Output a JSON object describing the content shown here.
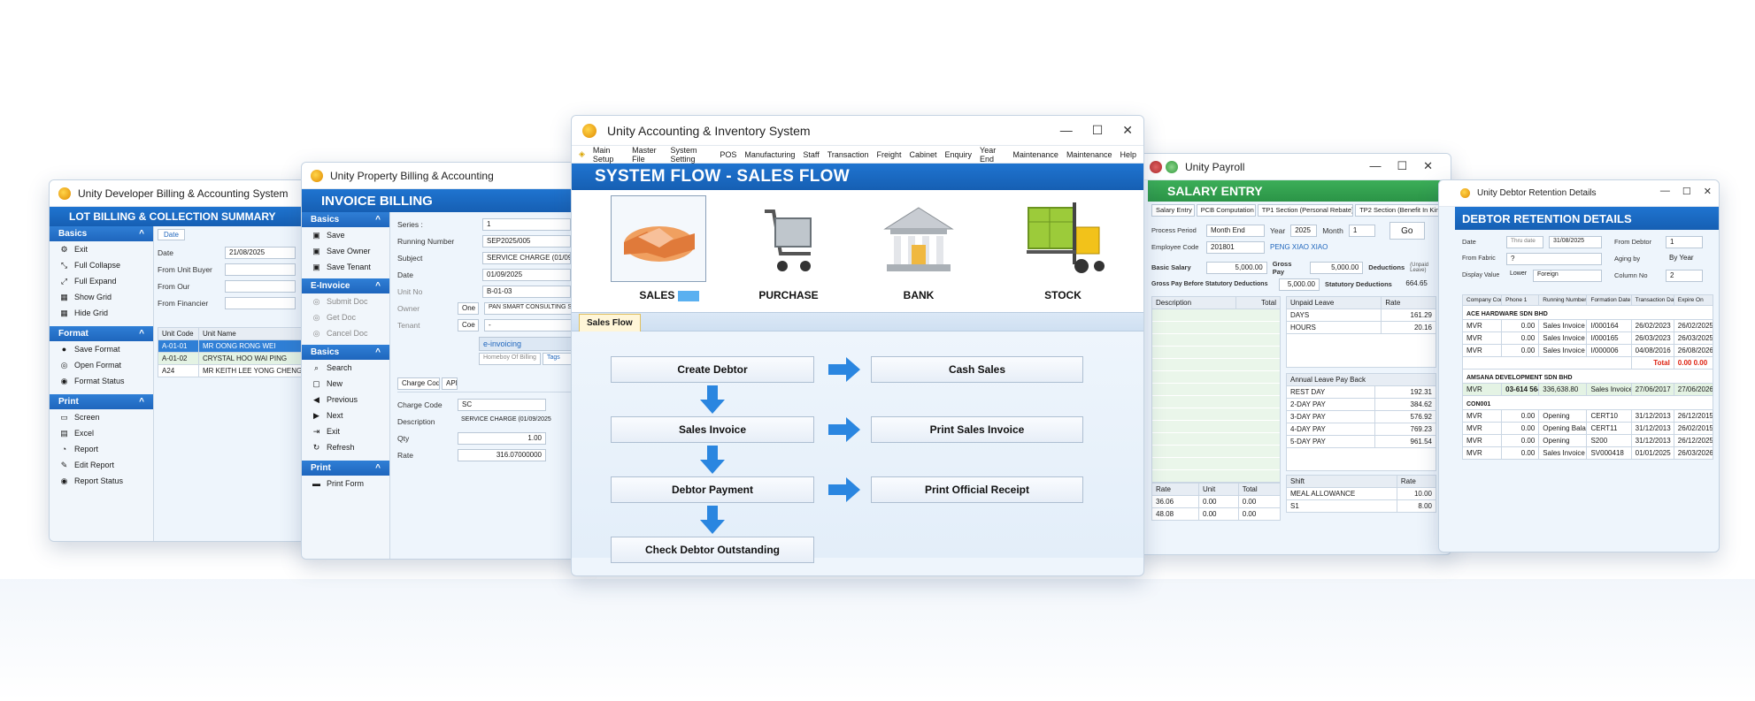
{
  "w1": {
    "title": "Unity Developer Billing & Accounting System",
    "band": "LOT BILLING & COLLECTION SUMMARY",
    "basics": "Basics",
    "basics_items": [
      "Exit",
      "Full Collapse",
      "Full Expand",
      "Show Grid",
      "Hide Grid"
    ],
    "format": "Format",
    "format_items": [
      "Save Format",
      "Open Format",
      "Format Status"
    ],
    "print": "Print",
    "print_items": [
      "Screen",
      "Excel",
      "Report",
      "Edit Report",
      "Report Status"
    ],
    "tab": "Date",
    "filters": [
      {
        "label": "Date",
        "value": "21/08/2025"
      },
      {
        "label": "From Unit Buyer",
        "value": ""
      },
      {
        "label": "From Our",
        "value": ""
      },
      {
        "label": "From Financier",
        "value": ""
      }
    ],
    "cols": [
      "Unit Code",
      "Unit Name"
    ],
    "rows": [
      [
        "A-01-01",
        "MR OONG RONG WEI"
      ],
      [
        "A-01-02",
        "CRYSTAL HOO WAI PING"
      ],
      [
        "A24",
        "MR KEITH LEE YONG CHENG"
      ]
    ]
  },
  "w2": {
    "title": "Unity Property Billing & Accounting",
    "band": "INVOICE BILLING",
    "basics": "Basics",
    "basics_items": [
      "Save",
      "Save Owner",
      "Save Tenant"
    ],
    "einv": "E-Invoice",
    "einv_items": [
      "Submit Doc",
      "Get Doc",
      "Cancel Doc"
    ],
    "basics2": "Basics",
    "basics2_items": [
      "Search",
      "New",
      "Previous",
      "Next",
      "Exit",
      "Refresh"
    ],
    "print": "Print",
    "print_items": [
      "Print Form"
    ],
    "fields": [
      {
        "label": "Series :",
        "value": "1"
      },
      {
        "label": "Running Number",
        "value": "SEP2025/005"
      },
      {
        "label": "Subject",
        "value": "SERVICE CHARGE (01/09/2025"
      },
      {
        "label": "Date",
        "value": "01/09/2025"
      },
      {
        "label": "Unit No",
        "value": "B-01-03"
      }
    ],
    "owner_label": "Owner",
    "owner_btn": "One",
    "owner_val": "PAN SMART CONSULTING SDN",
    "tenant_label": "Tenant",
    "tenant_btn": "Coe",
    "tenant_val": "-",
    "einv_tab": "e-invoicing",
    "homeboy": "Homeboy Of Billing",
    "tags": "Tags",
    "tabs": [
      "Charge Code",
      "API"
    ],
    "charge": [
      {
        "label": "Charge Code",
        "value": "SC"
      },
      {
        "label": "Description",
        "value": "SERVICE CHARGE (01/09/2025"
      },
      {
        "label": "Qty",
        "value": "1.00"
      },
      {
        "label": "Rate",
        "value": "316.07000000"
      }
    ]
  },
  "w3": {
    "title": "Unity Accounting & Inventory System",
    "menu": [
      "Main Setup",
      "Master File",
      "System Setting",
      "POS",
      "Manufacturing",
      "Staff",
      "Transaction",
      "Freight",
      "Cabinet",
      "Enquiry",
      "Year End",
      "Maintenance",
      "Maintenance",
      "Help"
    ],
    "band": "SYSTEM FLOW - SALES FLOW",
    "modules": [
      "SALES",
      "PURCHASE",
      "BANK",
      "STOCK"
    ],
    "tab": "Sales Flow",
    "left": [
      "Create Debtor",
      "Sales Invoice",
      "Debtor Payment",
      "Check Debtor Outstanding"
    ],
    "right": [
      "Cash Sales",
      "Print Sales Invoice",
      "Print Official Receipt"
    ]
  },
  "w4": {
    "title": "Unity Payroll",
    "band": "SALARY ENTRY",
    "tabs": [
      "Salary Entry",
      "PCB Computation",
      "TP1 Section (Personal Rebate)",
      "TP2 Section (Benefit In Kind)"
    ],
    "process_label": "Process Period",
    "process_val": "Month End",
    "year_label": "Year",
    "year_val": "2025",
    "month_label": "Month",
    "month_val": "1",
    "go": "Go",
    "emp_label": "Employee Code",
    "emp_val": "201801",
    "emp_name": "PENG XIAO XIAO",
    "basic_label": "Basic Salary",
    "basic_val": "5,000.00",
    "gross_label": "Gross Pay",
    "gross_val": "5,000.00",
    "ded_label": "Deductions",
    "ded_note": "(Unpaid Leave)",
    "gpb_label": "Gross Pay Before Statutory Deductions",
    "gpb_val": "5,000.00",
    "sd_label": "Statutory Deductions",
    "sd_val": "664.65",
    "desc_cols": [
      "Description",
      "Total"
    ],
    "unpaid_cols": [
      "Unpaid Leave",
      "Rate"
    ],
    "unpaid": [
      [
        "DAYS",
        "161.29"
      ],
      [
        "HOURS",
        "20.16"
      ]
    ],
    "annual": "Annual Leave Pay Back",
    "annual_rows": [
      [
        "REST DAY",
        "192.31"
      ],
      [
        "2-DAY PAY",
        "384.62"
      ],
      [
        "3-DAY PAY",
        "576.92"
      ],
      [
        "4-DAY PAY",
        "769.23"
      ],
      [
        "5-DAY PAY",
        "961.54"
      ]
    ],
    "rate_cols": [
      "Rate",
      "Unit",
      "Total"
    ],
    "rate_rows": [
      [
        "36.06",
        "0.00",
        "0.00"
      ],
      [
        "48.08",
        "0.00",
        "0.00"
      ]
    ],
    "shift_cols": [
      "Shift",
      "Rate"
    ],
    "shift_rows": [
      [
        "MEAL ALLOWANCE",
        "10.00"
      ],
      [
        "S1",
        "8.00"
      ]
    ]
  },
  "w5": {
    "title": "Unity Debtor Retention Details",
    "band": "DEBTOR RETENTION DETAILS",
    "f_date": "Date",
    "f_date_op": "Thru date",
    "f_date_val": "31/08/2025",
    "f_from": "From Debtor",
    "f_from_val": "1",
    "f_fab": "From Fabric",
    "f_fab_val": "?",
    "f_aging": "Aging by",
    "f_aging_val": "By Year",
    "f_disp": "Display Value",
    "f_disp_op": "Lower",
    "f_disp_val": "Foreign",
    "f_col": "Column No",
    "f_col_val": "2",
    "cols": [
      "Company Code",
      "Phone 1",
      "Running Number",
      "Formation Date",
      "Transaction Date",
      "Expire On"
    ],
    "g1": "ACE HARDWARE SDN BHD",
    "g1_rows": [
      [
        "MVR",
        "0.00",
        "Sales Invoice",
        "I/000164",
        "26/02/2023",
        "26/02/2025"
      ],
      [
        "MVR",
        "0.00",
        "Sales Invoice",
        "I/000165",
        "26/03/2023",
        "26/03/2025"
      ],
      [
        "MVR",
        "0.00",
        "Sales Invoice",
        "I/000006",
        "04/08/2016",
        "26/08/2026"
      ]
    ],
    "total_label": "Total",
    "total_val": "0.00 0.00",
    "g2": "AMSANA DEVELOPMENT SDN BHD",
    "g2_row": [
      "MVR",
      "03-614 5644",
      "336,638.80",
      "Sales Invoice",
      "27/06/2017",
      "27/06/2026"
    ],
    "g3": "CON001",
    "g3_rows": [
      [
        "MVR",
        "0.00",
        "Opening",
        "CERT10",
        "31/12/2013",
        "26/12/2015"
      ],
      [
        "MVR",
        "0.00",
        "Opening Balance",
        "CERT11",
        "31/12/2013",
        "26/02/2015"
      ],
      [
        "MVR",
        "0.00",
        "Opening",
        "S200",
        "31/12/2013",
        "26/12/2025"
      ],
      [
        "MVR",
        "0.00",
        "Sales Invoice",
        "SV000418",
        "01/01/2025",
        "26/03/2026"
      ]
    ]
  }
}
